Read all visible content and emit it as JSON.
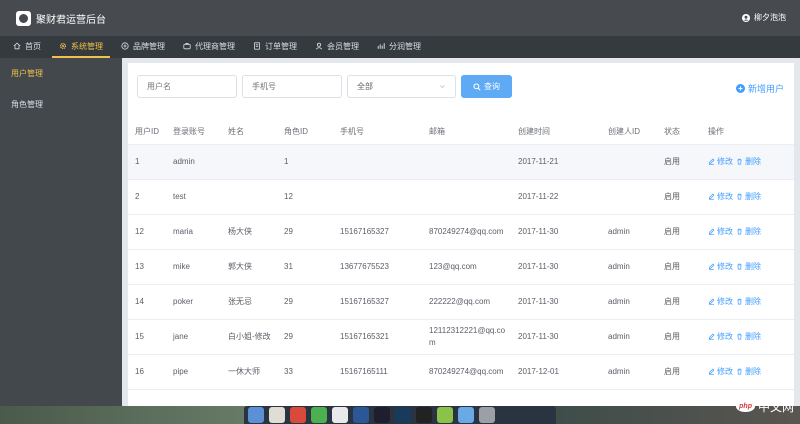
{
  "app": {
    "title": "聚财君运营后台",
    "user_name": "柳夕泡泡"
  },
  "menu": [
    {
      "label": "首页",
      "icon": "home-icon",
      "active": false
    },
    {
      "label": "系统管理",
      "icon": "gear-icon",
      "active": true
    },
    {
      "label": "品牌管理",
      "icon": "brand-icon",
      "active": false
    },
    {
      "label": "代理商管理",
      "icon": "agent-icon",
      "active": false
    },
    {
      "label": "订单管理",
      "icon": "order-icon",
      "active": false
    },
    {
      "label": "会员管理",
      "icon": "members-icon",
      "active": false
    },
    {
      "label": "分润管理",
      "icon": "profit-icon",
      "active": false
    }
  ],
  "sidebar": {
    "items": [
      {
        "label": "用户管理",
        "active": true
      },
      {
        "label": "角色管理",
        "active": false
      }
    ]
  },
  "filters": {
    "username_placeholder": "用户名",
    "phone_placeholder": "手机号",
    "status_value": "全部",
    "search_label": "查询"
  },
  "add_user_label": "新增用户",
  "table": {
    "columns": [
      "用户ID",
      "登录账号",
      "姓名",
      "角色ID",
      "手机号",
      "邮箱",
      "创建时间",
      "创建人ID",
      "状态",
      "操作"
    ],
    "rows": [
      [
        "1",
        "admin",
        "",
        "1",
        "",
        "",
        "2017-11-21",
        "",
        "启用"
      ],
      [
        "2",
        "test",
        "",
        "12",
        "",
        "",
        "2017-11-22",
        "",
        "启用"
      ],
      [
        "12",
        "maria",
        "杨大侠",
        "29",
        "15167165327",
        "870249274@qq.com",
        "2017-11-30",
        "admin",
        "启用"
      ],
      [
        "13",
        "mike",
        "郭大侠",
        "31",
        "13677675523",
        "123@qq.com",
        "2017-11-30",
        "admin",
        "启用"
      ],
      [
        "14",
        "poker",
        "张无忌",
        "29",
        "15167165327",
        "222222@qq.com",
        "2017-11-30",
        "admin",
        "启用"
      ],
      [
        "15",
        "jane",
        "白小姐-修改",
        "29",
        "15167165321",
        "12112312221@qq.com",
        "2017-11-30",
        "admin",
        "启用"
      ],
      [
        "16",
        "pipe",
        "一休大师",
        "33",
        "15167165111",
        "870249274@qq.com",
        "2017-12-01",
        "admin",
        "启用"
      ]
    ],
    "edit_label": "修改",
    "delete_label": "删除"
  },
  "watermark": {
    "logo": "php",
    "text": "中文网"
  },
  "colors": {
    "accent": "#f0c14b",
    "primary": "#409eff",
    "header": "#474b50",
    "sidebar": "#43484d"
  }
}
